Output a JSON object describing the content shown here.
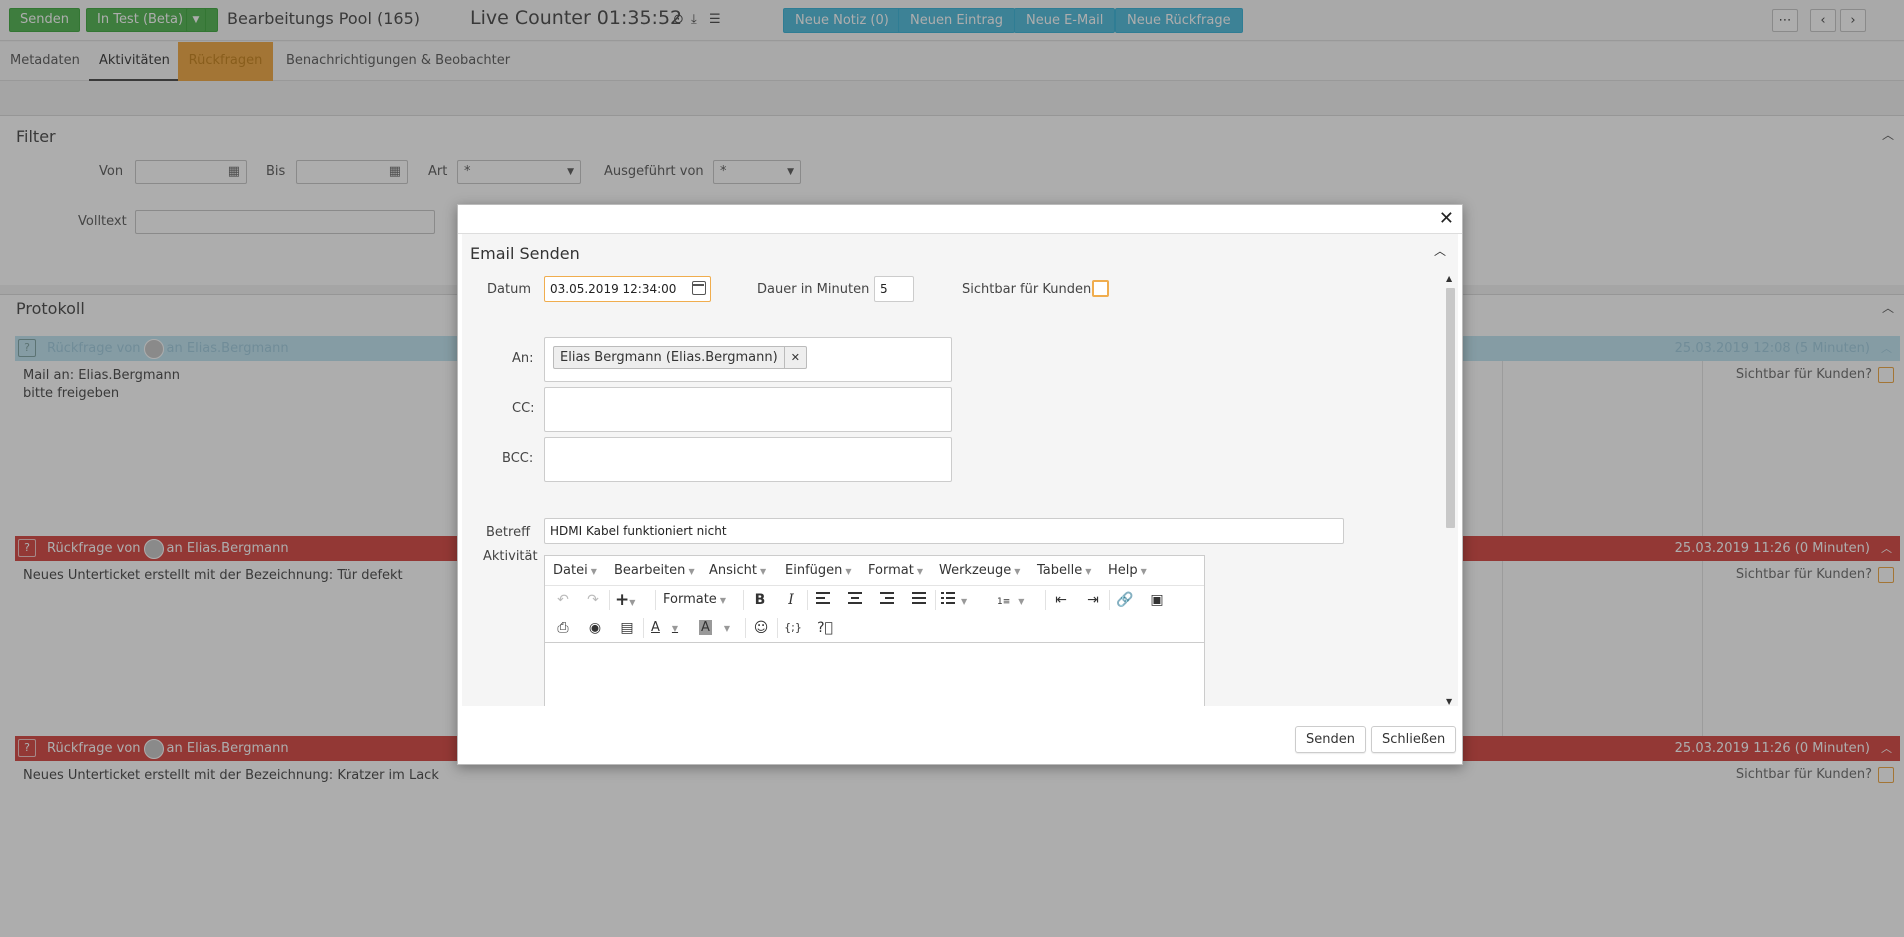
{
  "topbar": {
    "send_label": "Senden",
    "status_label": "In Test (Beta)",
    "pool_title": "Bearbeitungs Pool (165)",
    "live_counter": "Live Counter 01:35:52",
    "new_note": "Neue Notiz (0)",
    "new_entry": "Neuen Eintrag",
    "new_email": "Neue E-Mail",
    "new_query": "Neue Rückfrage",
    "more_icon": "more-icon",
    "prev_icon": "chevron-left-icon",
    "next_icon": "chevron-right-icon"
  },
  "tabs": [
    {
      "label": "Metadaten"
    },
    {
      "label": "Aktivitäten"
    },
    {
      "label": "Rückfragen"
    },
    {
      "label": "Benachrichtigungen & Beobachter"
    }
  ],
  "filter": {
    "title": "Filter",
    "von_label": "Von",
    "bis_label": "Bis",
    "art_label": "Art",
    "art_value": "*",
    "exec_label": "Ausgeführt von",
    "exec_value": "*",
    "fulltext_label": "Volltext"
  },
  "protokoll": {
    "title": "Protokoll",
    "rows": [
      {
        "head_left_prefix": "Rückfrage von",
        "head_left_suffix": "an Elias.Bergmann",
        "head_right": "25.03.2019 12:08 (5 Minuten)",
        "body_line1": "Mail an: Elias.Bergmann",
        "body_line2": "bitte freigeben",
        "visible_label": "Sichtbar für Kunden?"
      },
      {
        "head_left_prefix": "Rückfrage von",
        "head_left_suffix": "an Elias.Bergmann",
        "head_right": "25.03.2019 11:26 (0 Minuten)",
        "body_line1": "Neues Unterticket erstellt mit der Bezeichnung: Tür defekt",
        "visible_label": "Sichtbar für Kunden?"
      },
      {
        "head_left_prefix": "Rückfrage von",
        "head_left_suffix": "an Elias.Bergmann",
        "head_right": "25.03.2019 11:26 (0 Minuten)",
        "body_line1": "Neues Unterticket erstellt mit der Bezeichnung: Kratzer im Lack",
        "visible_label": "Sichtbar für Kunden?"
      }
    ]
  },
  "modal": {
    "title": "Email Senden",
    "datum_label": "Datum",
    "datum_value": "03.05.2019 12:34:00",
    "dauer_label": "Dauer in Minuten",
    "dauer_value": "5",
    "sichtbar_label": "Sichtbar für Kunden",
    "an_label": "An:",
    "an_tag": "Elias Bergmann (Elias.Bergmann)",
    "cc_label": "CC:",
    "bcc_label": "BCC:",
    "betreff_label": "Betreff",
    "betreff_value": "HDMI Kabel funktioniert nicht",
    "aktivitaet_label": "Aktivität",
    "menus": [
      "Datei",
      "Bearbeiten",
      "Ansicht",
      "Einfügen",
      "Format",
      "Werkzeuge",
      "Tabelle",
      "Help"
    ],
    "formats_label": "Formate",
    "send_button": "Senden",
    "close_button": "Schließen"
  },
  "colors": {
    "accent_green": "#5cb85c",
    "accent_blue": "#5bc0de",
    "warning_orange": "#f0ad4e",
    "danger_red": "#d9534f"
  }
}
